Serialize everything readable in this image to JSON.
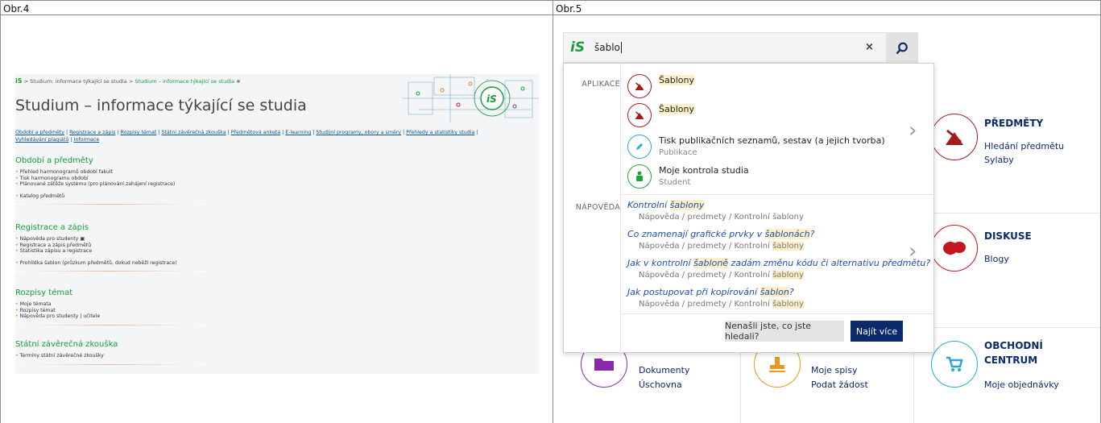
{
  "captions": {
    "left": "Obr.4",
    "right": "Obr.5"
  },
  "obr4": {
    "breadcrumb": {
      "logo": "iS",
      "sep": ">",
      "item1": "Studium: informace týkající se studia",
      "item2": "Studium – informace týkající se studia",
      "pin": "#"
    },
    "title": "Studium – informace týkající se studia",
    "links": [
      "Období a předměty",
      "Registrace a zápis",
      "Rozpisy témat",
      "Státní závěrečná zkouška",
      "Předmětová anketa",
      "E-learning",
      "Studijní programy, obory a směry",
      "Přehledy a statistiky studia",
      "Vyhledávání plagiátů",
      "Informace"
    ],
    "sections": [
      {
        "title": "Období a předměty",
        "items": [
          "Přehled harmonogramů období fakult",
          "Tisk harmonogramu období",
          "Plánované zátěže systému (pro plánování zahájení registrace)"
        ],
        "items2": [
          "Katalog předmětů"
        ]
      },
      {
        "title": "Registrace a zápis",
        "items": [
          "Nápověda pro studenty",
          "Registrace a zápis předmětů",
          "Statistika zápisu a registrace"
        ],
        "items2": [
          "Prohlídka šablon (průzkum předmětů, dokud neběží registrace)"
        ]
      },
      {
        "title": "Rozpisy témat",
        "items": [
          "Moje témata",
          "Rozpisy témat",
          "Nápověda pro studenty | učitele"
        ],
        "items2": []
      },
      {
        "title": "Státní závěrečná zkouška",
        "items": [
          "Termíny státní závěrečné zkoušky"
        ],
        "items2": []
      }
    ]
  },
  "obr5": {
    "search": {
      "logo": "iS",
      "query": "šablo",
      "clear": "×"
    },
    "dropdown": {
      "apps_label": "APLIKACE",
      "apps": [
        {
          "title": "Šablony",
          "sub": "",
          "icon": "tools-icon",
          "color": "#a61c1c"
        },
        {
          "title": "Šablony",
          "sub": "",
          "icon": "tools-icon",
          "color": "#a61c1c"
        },
        {
          "title": "Tisk publikačních seznamů, sestav (a jejich tvorba)",
          "sub": "Publikace",
          "icon": "pen-icon",
          "color": "#2aa7d8"
        },
        {
          "title": "Moje kontrola studia",
          "sub": "Student",
          "icon": "student-icon",
          "color": "#23a33c"
        }
      ],
      "help_label": "NÁPOVĚDA",
      "help": [
        {
          "pre": "Kontrolní ",
          "hl": "šablony",
          "post": "",
          "path": "Nápověda / predmety / Kontrolní šablony",
          "path_hl": ""
        },
        {
          "pre": "Co znamenají grafické prvky v ",
          "hl": "šablonách",
          "post": "?",
          "path": "Nápověda / predmety / Kontrolní ",
          "path_hl": "šablony"
        },
        {
          "pre": "Jak v kontrolní ",
          "hl": "šabloně",
          "post": " zadám změnu kódu či alternativu předmětu?",
          "path": "Nápověda / predmety / Kontrolní ",
          "path_hl": "šablony"
        },
        {
          "pre": "Jak postupovat při kopírování ",
          "hl": "šablon",
          "post": "?",
          "path": "Nápověda / predmety / Kontrolní ",
          "path_hl": "šablony"
        }
      ],
      "btn_notfound": "Nenašli jste, co jste hledali?",
      "btn_more": "Najít více"
    },
    "tiles": [
      {
        "title": "PŘEDMĚTY",
        "links": [
          "Hledání předmětu",
          "Sylaby"
        ],
        "color": "#a61c1c"
      },
      {
        "title": "DISKUSE",
        "links": [
          "Blogy"
        ],
        "color": "#c4161c"
      },
      {
        "title": "OBCHODNÍ",
        "title2": "CENTRUM",
        "links": [
          "Moje objednávky"
        ],
        "color": "#2aa7d8"
      },
      {
        "title": "",
        "links": [
          "Dokumenty",
          "Úschovna"
        ],
        "color": "#8a2aa8"
      },
      {
        "title": "",
        "links": [
          "Moje spisy",
          "Podat žádost"
        ],
        "color": "#e89a1c"
      }
    ]
  }
}
